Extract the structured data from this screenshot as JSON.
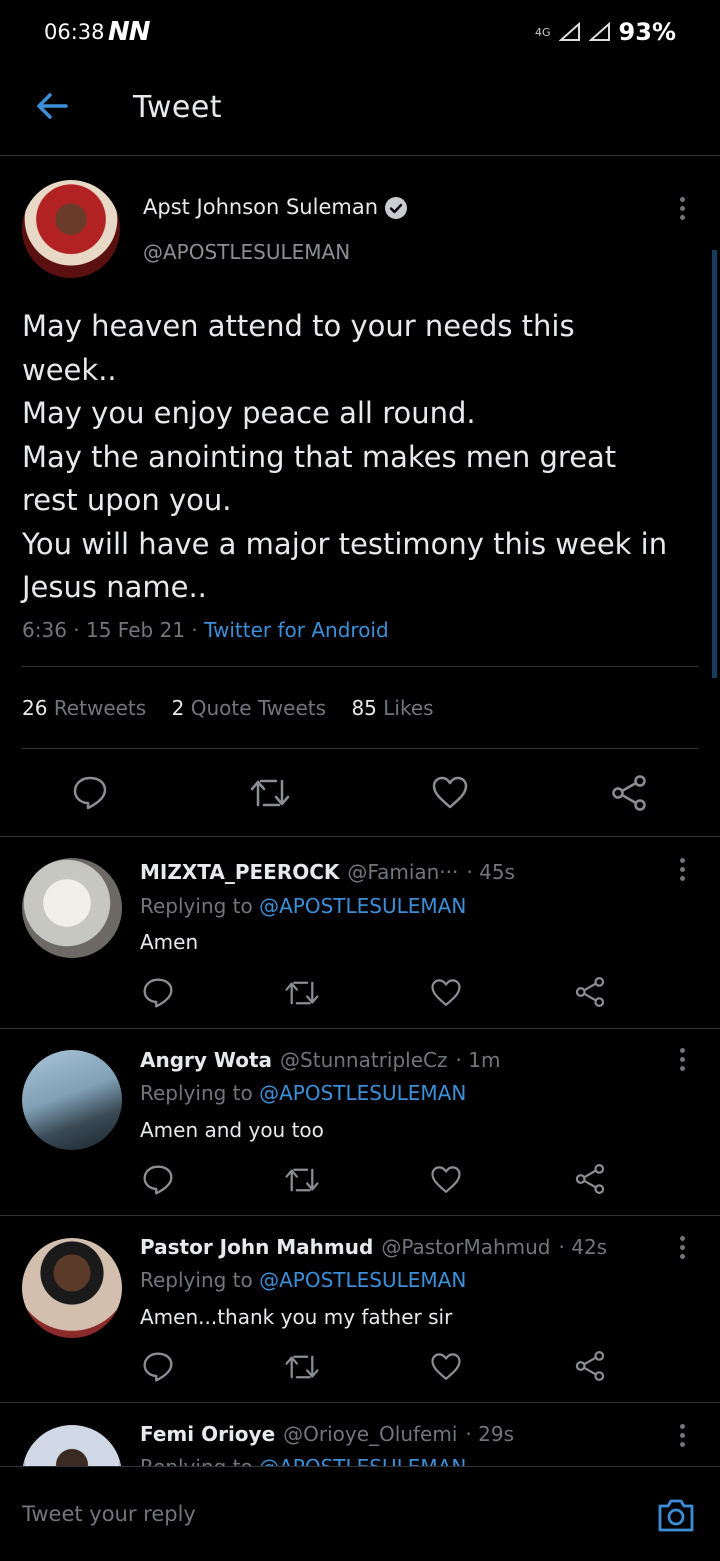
{
  "status_bar": {
    "time": "06:38",
    "logo": "NN",
    "network": "4G",
    "battery": "93%"
  },
  "header": {
    "title": "Tweet"
  },
  "tweet": {
    "author_name": "Apst Johnson Suleman",
    "handle": "@APOSTLESULEMAN",
    "lines": [
      "May heaven attend to your needs this",
      "week..",
      "May you enjoy peace all round.",
      "May the anointing that makes men great",
      "rest upon you.",
      "You will have a major testimony this week in",
      "Jesus name.."
    ],
    "time": "6:36",
    "date": "15 Feb 21",
    "source": "Twitter for Android",
    "retweets": "26",
    "retweets_label": "Retweets",
    "quotes": "2",
    "quotes_label": "Quote Tweets",
    "likes": "85",
    "likes_label": "Likes"
  },
  "replies": [
    {
      "name": "MIZXTA_PEEROCK",
      "handle": "@Famian···",
      "time": "· 45s",
      "replying_prefix": "Replying to",
      "replying_to": "@APOSTLESULEMAN",
      "text": "Amen"
    },
    {
      "name": "Angry Wota",
      "handle": "@StunnatripleCz",
      "time": "· 1m",
      "replying_prefix": "Replying to",
      "replying_to": "@APOSTLESULEMAN",
      "text": "Amen and you too"
    },
    {
      "name": "Pastor John Mahmud",
      "handle": "@PastorMahmud",
      "time": "· 42s",
      "replying_prefix": "Replying to",
      "replying_to": "@APOSTLESULEMAN",
      "text": "Amen...thank you my father sir"
    },
    {
      "name": "Femi Orioye",
      "handle": "@Orioye_Olufemi",
      "time": "· 29s",
      "replying_prefix": "Replying to",
      "replying_to": "@APOSTLESULEMAN",
      "text": ""
    }
  ],
  "composer": {
    "placeholder": "Tweet your reply"
  },
  "colors": {
    "background": "#000000",
    "link": "#3d8fd8",
    "muted": "#71767b",
    "text": "#e7e9ea"
  }
}
